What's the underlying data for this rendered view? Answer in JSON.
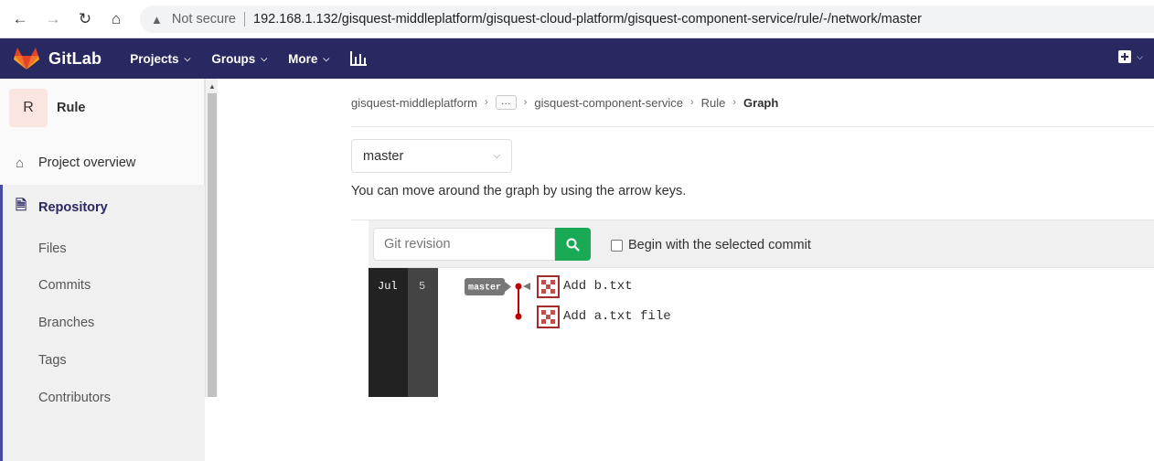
{
  "browser": {
    "security_label": "Not secure",
    "url": "192.168.1.132/gisquest-middleplatform/gisquest-cloud-platform/gisquest-component-service/rule/-/network/master"
  },
  "header": {
    "brand": "GitLab",
    "nav": [
      "Projects",
      "Groups",
      "More"
    ],
    "bg_color": "#292961"
  },
  "sidebar": {
    "project_initial": "R",
    "project_name": "Rule",
    "overview": "Project overview",
    "repository": "Repository",
    "repo_items": [
      "Files",
      "Commits",
      "Branches",
      "Tags",
      "Contributors"
    ]
  },
  "breadcrumb": {
    "items": [
      "gisquest-middleplatform",
      "…",
      "gisquest-component-service",
      "Rule"
    ],
    "current": "Graph"
  },
  "ref_select": {
    "value": "master"
  },
  "hint": "You can move around the graph by using the arrow keys.",
  "graph_toolbar": {
    "placeholder": "Git revision",
    "checkbox_label": "Begin with the selected commit"
  },
  "graph": {
    "month": "Jul",
    "day": "5",
    "branch_label": "master",
    "commits": [
      {
        "message": "Add b.txt"
      },
      {
        "message": "Add a.txt file"
      }
    ],
    "line_color": "#c00000"
  }
}
